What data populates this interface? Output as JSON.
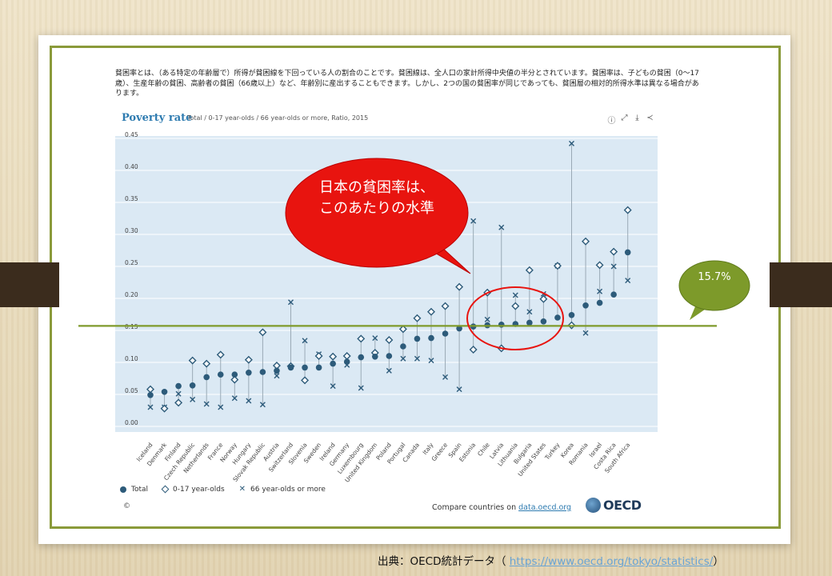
{
  "intro_text": "貧困率とは、（ある特定の年齢層で）所得が貧困線を下回っている人の割合のことです。貧困線は、全人口の家計所得中央値の半分とされています。貧困率は、子どもの貧困（0〜17歳）、生産年齢の貧困、高齢者の貧困（66歳以上）など、年齢別に産出することもできます。しかし、2つの国の貧困率が同じであっても、貧困層の相対的所得水準は異なる場合があります。",
  "widget": {
    "title": "Poverty rate",
    "subtitle": "Total / 0-17 year-olds / 66 year-olds or more, Ratio, 2015",
    "copyright": "©",
    "compare_prefix": "Compare countries on ",
    "compare_link": "data.oecd.org",
    "logo_text": "OECD",
    "tools": [
      "info-icon",
      "expand-icon",
      "download-icon",
      "share-icon"
    ]
  },
  "annotation": {
    "bubble_text": "日本の貧困率は、このあたりの水準",
    "reference_label": "15.7%",
    "reference_value": 0.157,
    "bubble_color": "#e8140f",
    "line_color": "#7f9a2b",
    "highlight_color": "#e8140f"
  },
  "source_prefix": "出典：OECD統計データ（ ",
  "source_url": "https://www.oecd.org/tokyo/statistics/",
  "source_suffix": "）",
  "colors": {
    "plot_bg": "#dbe9f4",
    "marker": "#2d5b7a",
    "grid": "#ffffff"
  },
  "chart_data": {
    "type": "scatter",
    "ylim": [
      0,
      0.45
    ],
    "yticks": [
      "0.00",
      "0.05",
      "0.10",
      "0.15",
      "0.20",
      "0.25",
      "0.30",
      "0.35",
      "0.40",
      "0.45"
    ],
    "categories": [
      "Iceland",
      "Denmark",
      "Finland",
      "Czech Republic",
      "Netherlands",
      "France",
      "Norway",
      "Hungary",
      "Slovak Republic",
      "Austria",
      "Switzerland",
      "Slovenia",
      "Sweden",
      "Ireland",
      "Germany",
      "Luxembourg",
      "United Kingdom",
      "Poland",
      "Portugal",
      "Canada",
      "Italy",
      "Greece",
      "Spain",
      "Estonia",
      "Chile",
      "Latvia",
      "Lithuania",
      "Bulgaria",
      "United States",
      "Turkey",
      "Korea",
      "Romania",
      "Israel",
      "Costa Rica",
      "South Africa"
    ],
    "series": [
      {
        "name": "Total",
        "marker": "dot",
        "values": [
          0.049,
          0.054,
          0.063,
          0.064,
          0.077,
          0.081,
          0.081,
          0.084,
          0.085,
          0.087,
          0.092,
          0.092,
          0.092,
          0.098,
          0.101,
          0.108,
          0.109,
          0.11,
          0.125,
          0.137,
          0.138,
          0.145,
          0.153,
          0.156,
          0.158,
          0.159,
          0.16,
          0.162,
          0.164,
          0.17,
          0.174,
          0.189,
          0.193,
          0.206,
          0.272
        ]
      },
      {
        "name": "0-17 year-olds",
        "marker": "diamond",
        "values": [
          0.058,
          0.028,
          0.037,
          0.103,
          0.098,
          0.112,
          0.073,
          0.104,
          0.147,
          0.095,
          0.094,
          0.072,
          0.11,
          0.109,
          0.11,
          0.137,
          0.115,
          0.135,
          0.152,
          0.169,
          0.179,
          0.188,
          0.218,
          0.12,
          0.209,
          0.122,
          0.188,
          0.244,
          0.199,
          0.251,
          0.158,
          0.289,
          0.252,
          0.273,
          0.338
        ]
      },
      {
        "name": "66 year-olds or more",
        "marker": "x",
        "values": [
          0.03,
          0.03,
          0.051,
          0.042,
          0.035,
          0.03,
          0.044,
          0.04,
          0.034,
          0.079,
          0.194,
          0.134,
          0.113,
          0.063,
          0.096,
          0.06,
          0.138,
          0.087,
          0.106,
          0.106,
          0.103,
          0.077,
          0.058,
          0.321,
          0.167,
          0.311,
          0.205,
          0.179,
          0.207,
          0.251,
          0.442,
          0.146,
          0.211,
          0.25,
          0.228
        ]
      }
    ],
    "legend": "bottom-left",
    "grid": true
  }
}
